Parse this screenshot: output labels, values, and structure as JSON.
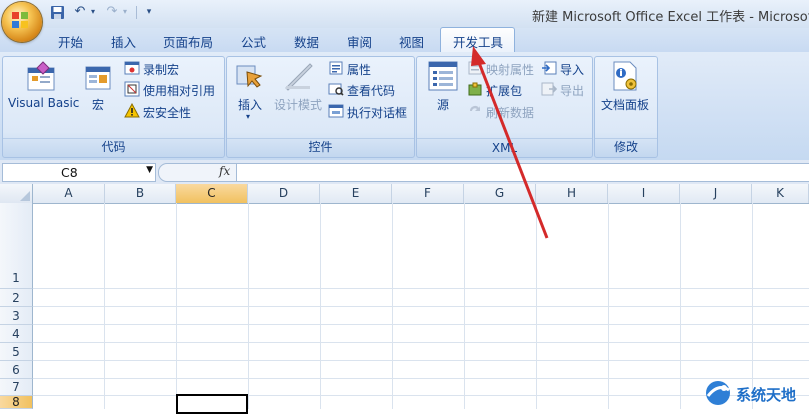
{
  "window": {
    "title": "新建 Microsoft Office Excel 工作表 - Microsoft E"
  },
  "quick_access": {
    "undo_icon": "undo-icon",
    "redo_icon": "redo-icon",
    "customize_icon": "customize-dropdown-icon"
  },
  "tabs": [
    {
      "label": "开始"
    },
    {
      "label": "插入"
    },
    {
      "label": "页面布局"
    },
    {
      "label": "公式"
    },
    {
      "label": "数据"
    },
    {
      "label": "审阅"
    },
    {
      "label": "视图"
    },
    {
      "label": "开发工具",
      "active": true
    }
  ],
  "ribbon": {
    "code": {
      "label": "代码",
      "visual_basic": "Visual Basic",
      "macros": "宏",
      "record_macro": "录制宏",
      "relative_ref": "使用相对引用",
      "macro_security": "宏安全性"
    },
    "controls": {
      "label": "控件",
      "insert": "插入",
      "design_mode": "设计模式",
      "properties": "属性",
      "view_code": "查看代码",
      "run_dialog": "执行对话框"
    },
    "xml": {
      "label": "XML",
      "source": "源",
      "map_properties": "映射属性",
      "expansion_packs": "扩展包",
      "refresh_data": "刷新数据",
      "import": "导入",
      "export": "导出"
    },
    "modify": {
      "label": "修改",
      "doc_panel": "文档面板"
    }
  },
  "formula_bar": {
    "name_box": "C8",
    "fx": "fx",
    "formula": ""
  },
  "sheet": {
    "columns": [
      "A",
      "B",
      "C",
      "D",
      "E",
      "F",
      "G",
      "H",
      "I",
      "J",
      "K"
    ],
    "selected_column": "C",
    "rows": [
      "1",
      "2",
      "3",
      "4",
      "5",
      "6",
      "7",
      "8"
    ],
    "active_cell": "C8"
  },
  "annotation": {
    "arrow_color": "#d42a2a"
  },
  "watermark": {
    "text": "系统天地"
  },
  "colors": {
    "ribbon": "#d0e0f4",
    "ribbon_text": "#15428b",
    "selected_header": "#f1c15f"
  }
}
